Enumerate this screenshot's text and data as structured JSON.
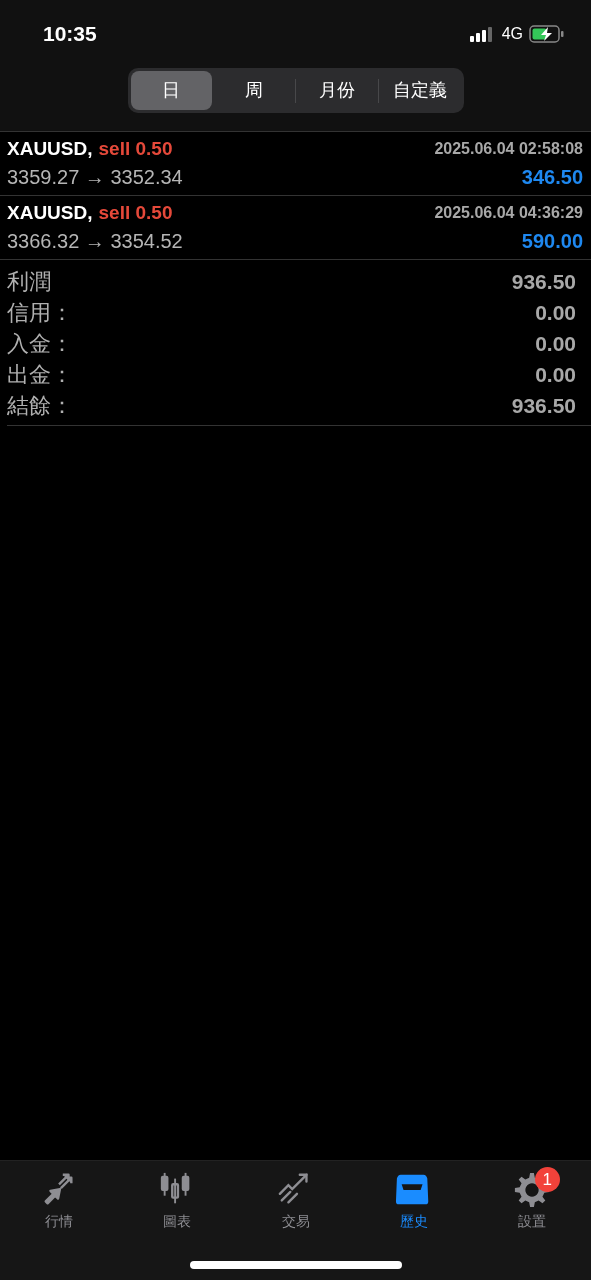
{
  "status_bar": {
    "time": "10:35",
    "network": "4G"
  },
  "period_tabs": [
    {
      "label": "日",
      "selected": true
    },
    {
      "label": "周",
      "selected": false
    },
    {
      "label": "月份",
      "selected": false
    },
    {
      "label": "自定義",
      "selected": false
    }
  ],
  "trades": [
    {
      "symbol": "XAUUSD,",
      "side": "sell 0.50",
      "time": "2025.06.04 02:58:08",
      "prices": "3359.27 → 3352.34",
      "profit": "346.50"
    },
    {
      "symbol": "XAUUSD,",
      "side": "sell 0.50",
      "time": "2025.06.04 04:36:29",
      "prices": "3366.32 → 3354.52",
      "profit": "590.00"
    }
  ],
  "summary": [
    {
      "label": "利潤",
      "value": "936.50"
    },
    {
      "label": "信用：",
      "value": "0.00"
    },
    {
      "label": "入金：",
      "value": "0.00"
    },
    {
      "label": "出金：",
      "value": "0.00"
    },
    {
      "label": "結餘：",
      "value": "936.50"
    }
  ],
  "tab_bar": [
    {
      "kind": "quotes",
      "label": "行情",
      "selected": false
    },
    {
      "kind": "chart",
      "label": "圖表",
      "selected": false
    },
    {
      "kind": "trade",
      "label": "交易",
      "selected": false
    },
    {
      "kind": "history",
      "label": "歷史",
      "selected": true
    },
    {
      "kind": "settings",
      "label": "設置",
      "selected": false,
      "badge": "1"
    }
  ]
}
